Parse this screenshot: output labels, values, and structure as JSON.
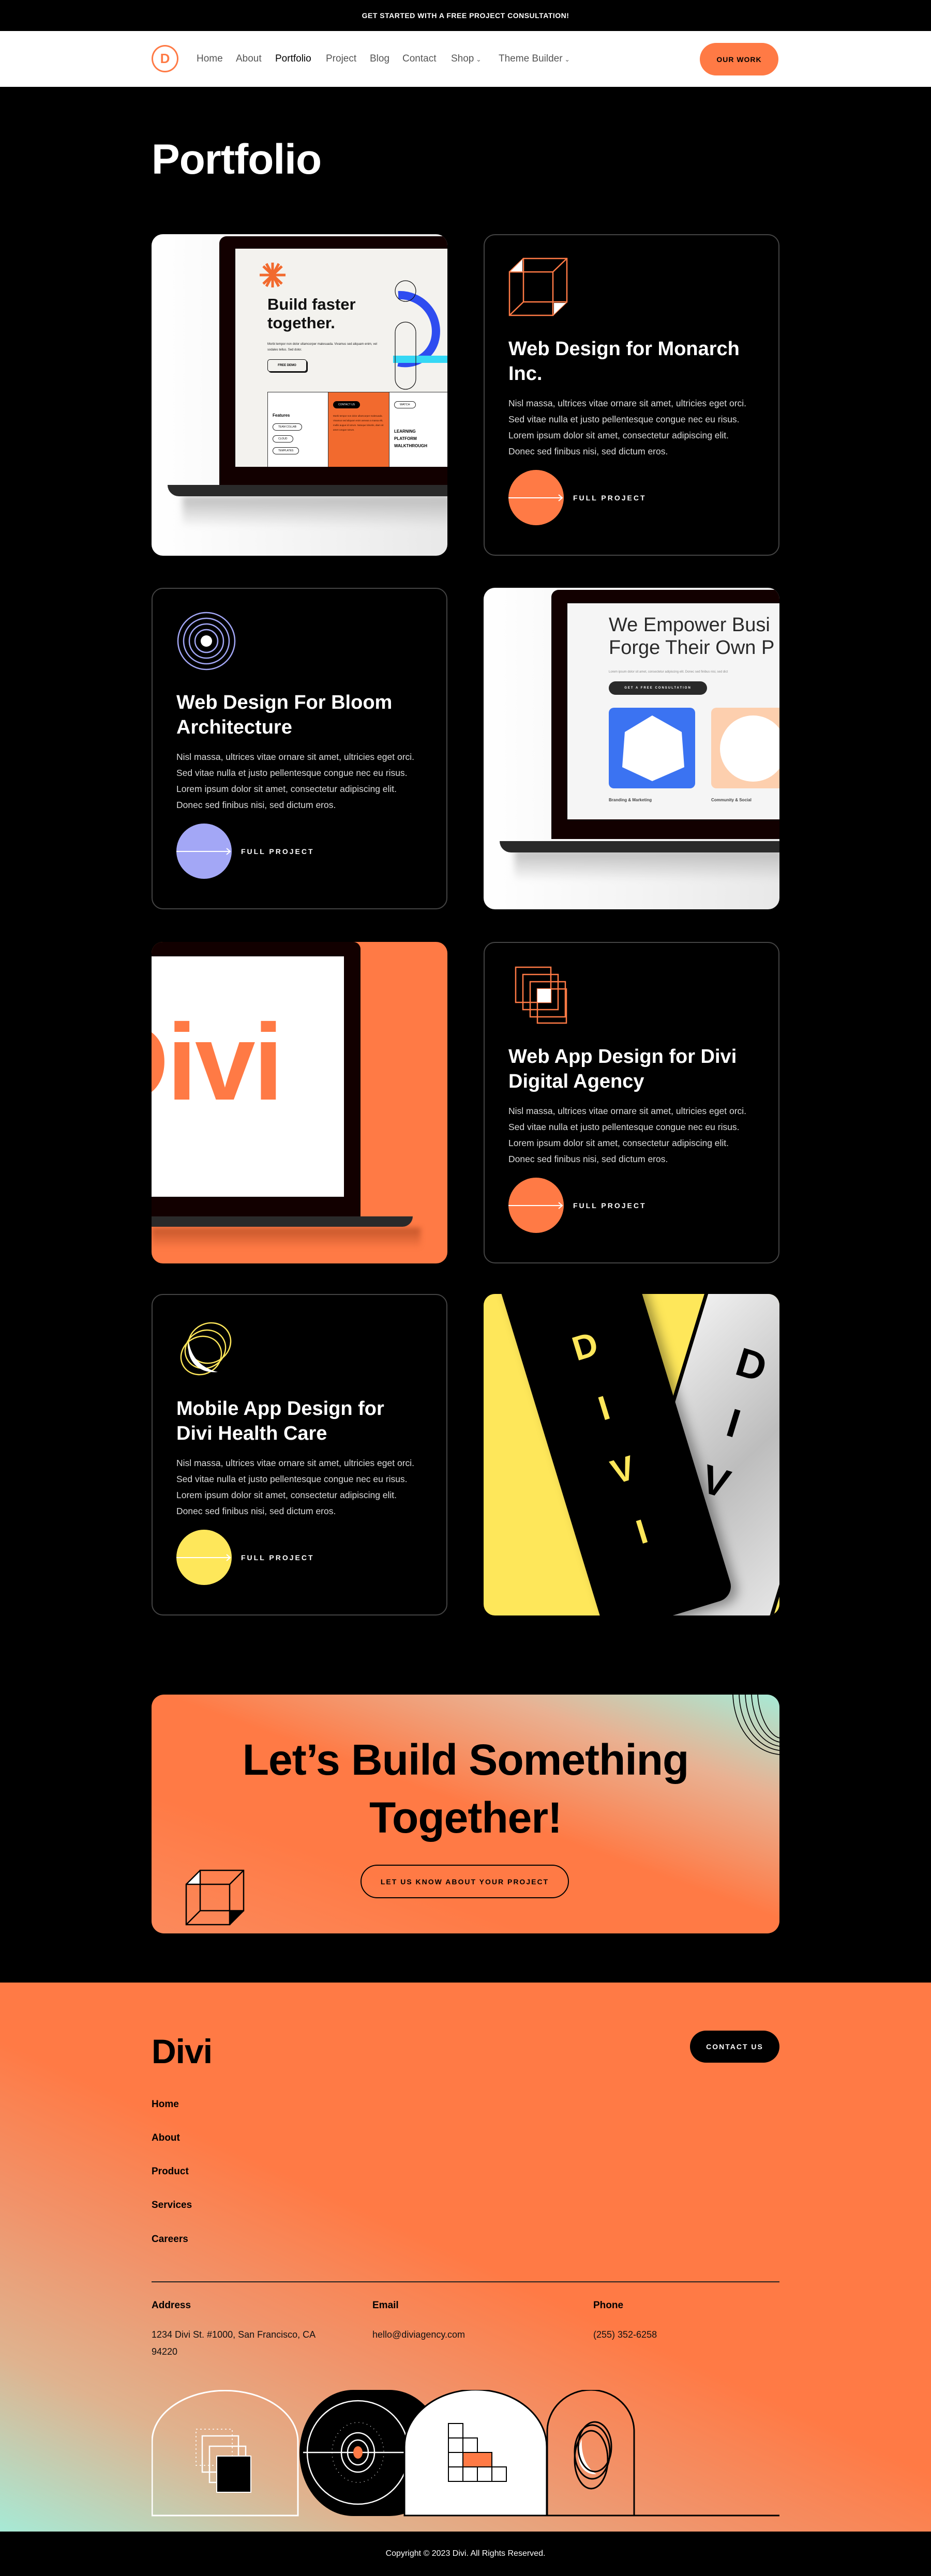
{
  "topbar": {
    "text": "GET STARTED WITH A FREE PROJECT CONSULTATION!"
  },
  "nav": {
    "logo_letter": "D",
    "items": [
      {
        "label": "Home"
      },
      {
        "label": "About"
      },
      {
        "label": "Portfolio",
        "active": true
      },
      {
        "label": "Project"
      },
      {
        "label": "Blog"
      },
      {
        "label": "Contact"
      },
      {
        "label": "Shop",
        "dropdown": true
      },
      {
        "label": "Theme Builder",
        "dropdown": true
      }
    ],
    "chevron": "⌄",
    "cta": "OUR WORK"
  },
  "page": {
    "title": "Portfolio"
  },
  "colors": {
    "accent": "#ff7a45",
    "lavender": "#a3a7f6",
    "yellow": "#fee75a",
    "black": "#000000"
  },
  "projects": [
    {
      "title": "Web Design for Monarch Inc.",
      "text": "Nisl massa, ultrices vitae ornare sit amet, ultricies eget orci. Sed vitae nulla et justo pellentesque congue nec eu risus. Lorem ipsum dolor sit amet, consectetur adipiscing elit. Donec sed finibus nisi, sed dictum eros.",
      "link": "FULL PROJECT",
      "icon": "cube-icon",
      "color": "#ff7a45"
    },
    {
      "title": "Web Design For Bloom Architecture",
      "text": "Nisl massa, ultrices vitae ornare sit amet, ultricies eget orci. Sed vitae nulla et justo pellentesque congue nec eu risus. Lorem ipsum dolor sit amet, consectetur adipiscing elit. Donec sed finibus nisi, sed dictum eros.",
      "link": "FULL PROJECT",
      "icon": "concentric-circles-icon",
      "color": "#a3a7f6"
    },
    {
      "title": "Web App Design for Divi Digital Agency",
      "text": "Nisl massa, ultrices vitae ornare sit amet, ultricies eget orci. Sed vitae nulla et justo pellentesque congue nec eu risus. Lorem ipsum dolor sit amet, consectetur adipiscing elit. Donec sed finibus nisi, sed dictum eros.",
      "link": "FULL PROJECT",
      "icon": "stacked-squares-icon",
      "color": "#ff7a45"
    },
    {
      "title": "Mobile App Design for Divi Health Care",
      "text": "Nisl massa, ultrices vitae ornare sit amet, ultricies eget orci. Sed vitae nulla et justo pellentesque congue nec eu risus. Lorem ipsum dolor sit amet, consectetur adipiscing elit. Donec sed finibus nisi, sed dictum eros.",
      "link": "FULL PROJECT",
      "icon": "orbit-rings-icon",
      "color": "#fee75a"
    }
  ],
  "mockups": {
    "monarch": {
      "heading": "Build faster together.",
      "para": "Morbi tempor non dolor ullamcorper malesuada. Vivamus sed aliquam enim, vel sodales tellus. Sed dolor.",
      "button": "FREE DEMO",
      "features": "Features",
      "tags": [
        "TEAM COLLAB",
        "CLOUD",
        "TEMPLATES"
      ],
      "contact": "CONTACT US",
      "orange_text": "Morbi tempor non dolor ullamcorper malesuada. Vivamus sed aliquam enim aenean a massa elit, mollis augue id rutrum. Natoque lobortis, diam sit amet congue rutrum.",
      "watch": "WATCH",
      "learning": "LEARNING PLATFORM WALKTHROUGH"
    },
    "bloom": {
      "heading_line1": "We Empower Busi",
      "heading_line2": "Forge Their Own P",
      "para": "Lorem ipsum dolor sit amet, consectetur adipiscing elit. Donec sed finibus nisi, sed dict",
      "button": "GET A FREE CONSULTATION",
      "tile1": "Branding & Marketing",
      "tile2": "Community & Social"
    },
    "agency": {
      "logo_text": "Divi"
    },
    "mobile": {
      "letters": [
        "D",
        "I",
        "V",
        "I"
      ]
    }
  },
  "cta": {
    "title": "Let’s Build Something Together!",
    "button": "LET US KNOW ABOUT YOUR PROJECT"
  },
  "footer": {
    "logo": "Divi",
    "contact": "CONTACT US",
    "links": [
      "Home",
      "About",
      "Product",
      "Services",
      "Careers"
    ],
    "address_label": "Address",
    "address": "1234 Divi St. #1000, San Francisco, CA 94220",
    "email_label": "Email",
    "email": "hello@diviagency.com",
    "phone_label": "Phone",
    "phone": "(255) 352-6258",
    "copyright": "Copyright © 2023 Divi. All Rights Reserved."
  }
}
